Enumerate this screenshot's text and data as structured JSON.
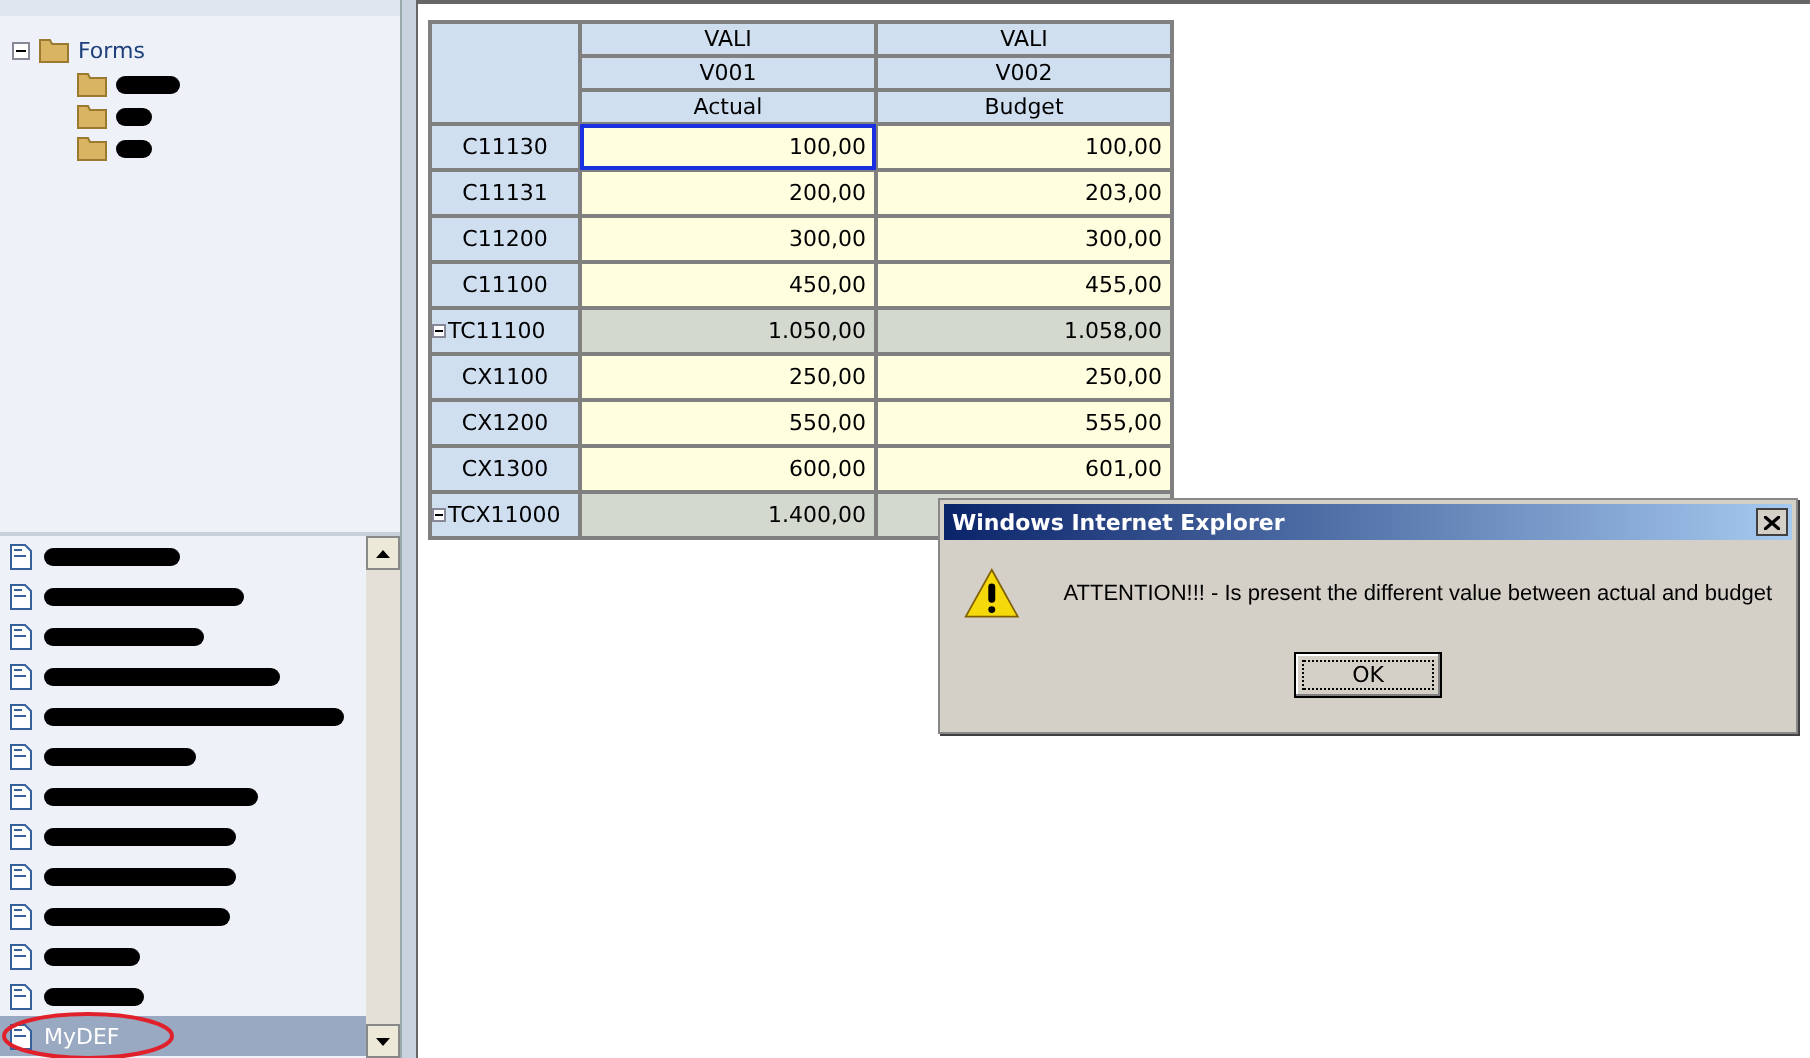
{
  "tree": {
    "label": "Forms",
    "expanded": true,
    "children": [
      {
        "kind": "redacted"
      },
      {
        "kind": "redacted"
      },
      {
        "kind": "redacted"
      }
    ]
  },
  "list": {
    "items": [
      {
        "kind": "redacted",
        "selected": false
      },
      {
        "kind": "redacted",
        "selected": false
      },
      {
        "kind": "redacted",
        "selected": false
      },
      {
        "kind": "redacted",
        "selected": false
      },
      {
        "kind": "redacted",
        "selected": false
      },
      {
        "kind": "redacted",
        "selected": false
      },
      {
        "kind": "redacted",
        "selected": false
      },
      {
        "kind": "redacted",
        "selected": false
      },
      {
        "kind": "redacted",
        "selected": false
      },
      {
        "kind": "redacted",
        "selected": false
      },
      {
        "kind": "redacted",
        "selected": false
      },
      {
        "kind": "redacted",
        "selected": false
      },
      {
        "kind": "document",
        "label": "MyDEF",
        "selected": true,
        "circled": true
      }
    ]
  },
  "grid": {
    "header_rows": [
      [
        "VALI",
        "VALI"
      ],
      [
        "V001",
        "V002"
      ],
      [
        "Actual",
        "Budget"
      ]
    ],
    "rows": [
      {
        "kind": "account",
        "label": "C11130",
        "cells": [
          {
            "value": "100,00",
            "focused": true
          },
          {
            "value": "100,00",
            "focused": false
          }
        ]
      },
      {
        "kind": "account",
        "label": "C11131",
        "cells": [
          {
            "value": "200,00",
            "focused": false
          },
          {
            "value": "203,00",
            "focused": false
          }
        ]
      },
      {
        "kind": "account",
        "label": "C11200",
        "cells": [
          {
            "value": "300,00",
            "focused": false
          },
          {
            "value": "300,00",
            "focused": false
          }
        ]
      },
      {
        "kind": "account",
        "label": "C11100",
        "cells": [
          {
            "value": "450,00",
            "focused": false
          },
          {
            "value": "455,00",
            "focused": false
          }
        ]
      },
      {
        "kind": "total",
        "label": "TC11100",
        "cells": [
          {
            "value": "1.050,00",
            "focused": false
          },
          {
            "value": "1.058,00",
            "focused": false
          }
        ]
      },
      {
        "kind": "account",
        "label": "CX1100",
        "cells": [
          {
            "value": "250,00",
            "focused": false
          },
          {
            "value": "250,00",
            "focused": false
          }
        ]
      },
      {
        "kind": "account",
        "label": "CX1200",
        "cells": [
          {
            "value": "550,00",
            "focused": false
          },
          {
            "value": "555,00",
            "focused": false
          }
        ]
      },
      {
        "kind": "account",
        "label": "CX1300",
        "cells": [
          {
            "value": "600,00",
            "focused": false
          },
          {
            "value": "601,00",
            "focused": false
          }
        ]
      },
      {
        "kind": "total",
        "label": "TCX11000",
        "cells": [
          {
            "value": "1.400,00",
            "focused": false
          },
          {}
        ]
      }
    ]
  },
  "dialog": {
    "title": "Windows Internet Explorer",
    "message": "ATTENTION!!! - Is present the different value between actual and budget",
    "button": "OK"
  }
}
